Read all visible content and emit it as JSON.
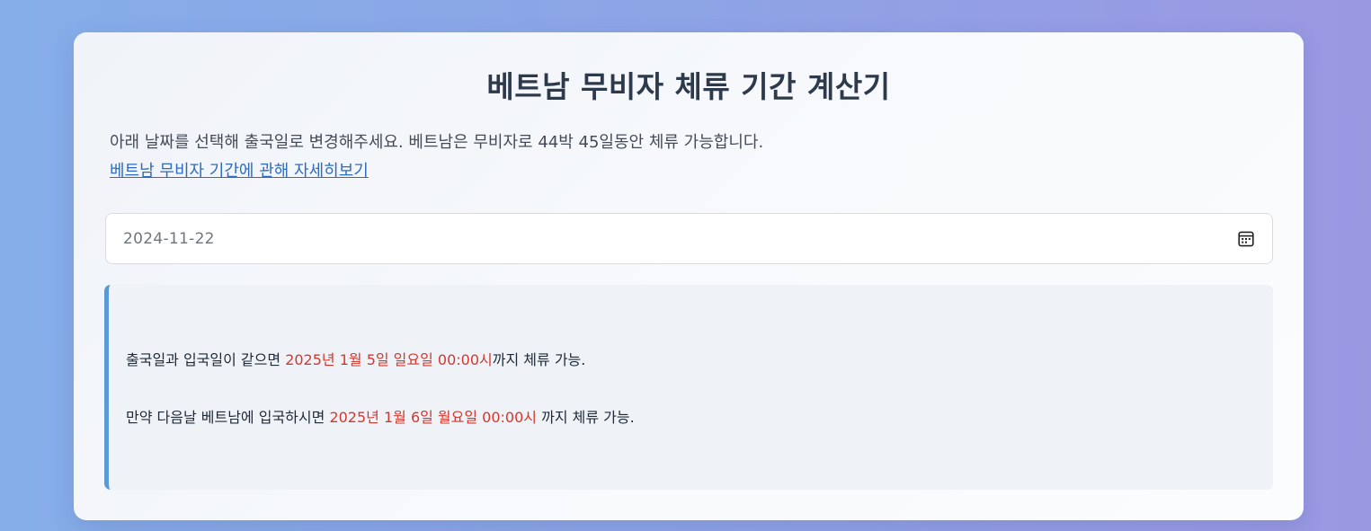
{
  "page": {
    "title": "베트남 무비자 체류 기간 계산기",
    "description": "아래 날짜를 선택해 출국일로 변경해주세요. 베트남은 무비자로 44박 45일동안 체류 가능합니다.",
    "more_link": "베트남 무비자 기간에 관해 자세히보기"
  },
  "date_input": {
    "value": "2024-11-22",
    "icon": "calendar-icon"
  },
  "result": {
    "line1": {
      "prefix": "출국일과 입국일이 같으면 ",
      "highlight": "2025년 1월 5일 일요일 00:00시",
      "suffix": "까지 체류 가능."
    },
    "line2": {
      "prefix": "만약 다음날 베트남에 입국하시면 ",
      "highlight": "2025년 1월 6일 월요일 00:00시",
      "suffix": " 까지 체류 가능."
    }
  },
  "colors": {
    "accent_highlight": "#d4372d",
    "link": "#2e6cc0",
    "result_border": "#5a9ad6",
    "title": "#2c3a4c"
  }
}
